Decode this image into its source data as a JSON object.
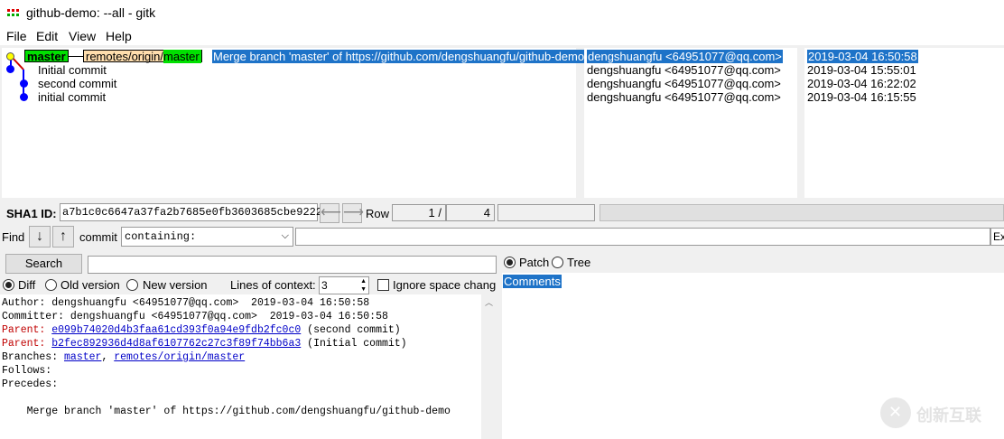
{
  "window": {
    "title": "github-demo: --all - gitk"
  },
  "menu": {
    "file": "File",
    "edit": "Edit",
    "view": "View",
    "help": "Help"
  },
  "refs": {
    "head": "master",
    "remote_prefix": "remotes/origin/",
    "remote_branch": "master"
  },
  "commits": [
    {
      "subject": "Merge branch 'master' of https://github.com/dengshuangfu/github-demo",
      "author": "dengshuangfu <64951077@qq.com>",
      "date": "2019-03-04 16:50:58"
    },
    {
      "subject": "Initial commit",
      "author": "dengshuangfu <64951077@qq.com>",
      "date": "2019-03-04 15:55:01"
    },
    {
      "subject": "second commit",
      "author": "dengshuangfu <64951077@qq.com>",
      "date": "2019-03-04 16:22:02"
    },
    {
      "subject": "initial commit",
      "author": "dengshuangfu <64951077@qq.com>",
      "date": "2019-03-04 16:15:55"
    }
  ],
  "sha1": {
    "label": "SHA1 ID:",
    "value": "a7b1c0c6647a37fa2b7685e0fb3603685cbe9222"
  },
  "row": {
    "label": "Row",
    "current": "1 /",
    "total": "4"
  },
  "find": {
    "label": "Find",
    "commit_label": "commit",
    "mode": "containing:",
    "ex_label": "Ex"
  },
  "search": {
    "button": "Search"
  },
  "diff_options": {
    "diff": "Diff",
    "old": "Old version",
    "new": "New version",
    "context_label": "Lines of context:",
    "context_value": "3",
    "ignore_space": "Ignore space chang"
  },
  "view_toggle": {
    "patch": "Patch",
    "tree": "Tree"
  },
  "file_list": {
    "comments": "Comments"
  },
  "details": {
    "author": "Author: dengshuangfu <64951077@qq.com>  2019-03-04 16:50:58",
    "committer": "Committer: dengshuangfu <64951077@qq.com>  2019-03-04 16:50:58",
    "parent_label": "Parent:",
    "parent1_sha": "e099b74020d4b3faa61cd393f0a94e9fdb2fc0c0",
    "parent1_desc": " (second commit)",
    "parent2_sha": "b2fec892936d4d8af6107762c27c3f89f74bb6a3",
    "parent2_desc": " (Initial commit)",
    "branches_label": "Branches: ",
    "branch1": "master",
    "branch_sep": ", ",
    "branch2": "remotes/origin/master",
    "follows": "Follows:",
    "precedes": "Precedes:",
    "message": "    Merge branch 'master' of https://github.com/dengshuangfu/github-demo"
  },
  "watermark": {
    "text": "创新互联"
  },
  "colors": {
    "selection": "#1e73c8",
    "head_ref": "#00e000",
    "remote_ref": "#ffdead",
    "parent_red": "#c00000",
    "link_blue": "#0000c8"
  }
}
